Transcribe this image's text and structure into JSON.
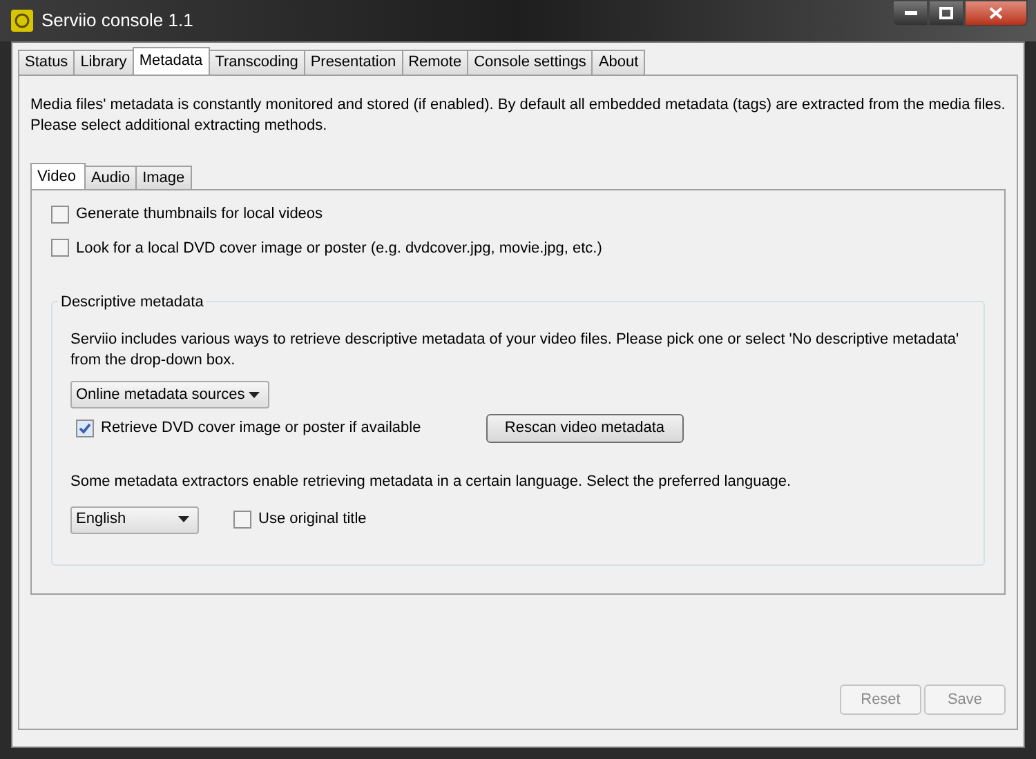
{
  "window": {
    "title": "Serviio console 1.1"
  },
  "tabs": [
    {
      "label": "Status",
      "selected": false
    },
    {
      "label": "Library",
      "selected": false
    },
    {
      "label": "Metadata",
      "selected": true
    },
    {
      "label": "Transcoding",
      "selected": false
    },
    {
      "label": "Presentation",
      "selected": false
    },
    {
      "label": "Remote",
      "selected": false
    },
    {
      "label": "Console settings",
      "selected": false
    },
    {
      "label": "About",
      "selected": false
    }
  ],
  "intro": "Media files' metadata is constantly monitored and stored (if enabled). By default all embedded metadata (tags) are extracted from the media files. Please select additional extracting methods.",
  "subtabs": [
    {
      "label": "Video",
      "selected": true
    },
    {
      "label": "Audio",
      "selected": false
    },
    {
      "label": "Image",
      "selected": false
    }
  ],
  "options": [
    {
      "label": "Generate thumbnails for local videos",
      "checked": false
    },
    {
      "label": "Look for a local DVD cover image or poster (e.g. dvdcover.jpg, movie.jpg, etc.)",
      "checked": false
    }
  ],
  "descriptive": {
    "title": "Descriptive metadata",
    "text": "Serviio includes various ways to retrieve descriptive metadata of your video files. Please pick one or select 'No descriptive metadata' from the drop-down box.",
    "source": "Online metadata sources",
    "retrieve_cover": {
      "label": "Retrieve DVD cover image or poster if available",
      "checked": true
    },
    "rescan_button": "Rescan video metadata",
    "language_text": "Some metadata extractors enable retrieving metadata in a certain language. Select the preferred language.",
    "language": "English",
    "original_title": {
      "label": "Use original title",
      "checked": false
    }
  },
  "buttons": [
    {
      "label": "Reset",
      "disabled": true
    },
    {
      "label": "Save",
      "disabled": true
    }
  ]
}
